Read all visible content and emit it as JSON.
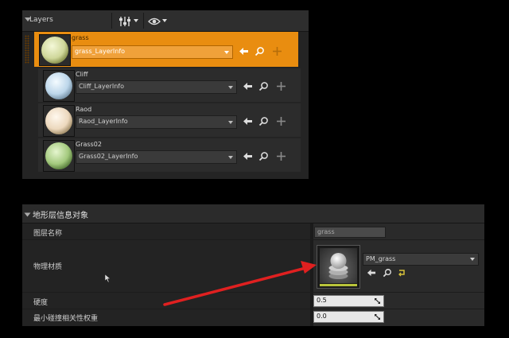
{
  "layers_panel": {
    "title": "Layers",
    "layers": [
      {
        "name": "grass",
        "info": "grass_LayerInfo",
        "selected": true,
        "thumb_color": "#d5dfa6"
      },
      {
        "name": "Cliff",
        "info": "Cliff_LayerInfo",
        "selected": false,
        "thumb_color": "#cfe3f2"
      },
      {
        "name": "Raod",
        "info": "Raod_LayerInfo",
        "selected": false,
        "thumb_color": "#f0e0c8"
      },
      {
        "name": "Grass02",
        "info": "Grass02_LayerInfo",
        "selected": false,
        "thumb_color": "#a9cf82"
      }
    ],
    "icons": [
      "left-arrow-icon",
      "search-icon",
      "plus-icon"
    ]
  },
  "details_panel": {
    "title": "地形层信息对象",
    "labels": {
      "layer_name": "图层名称",
      "physical_material": "物理材质",
      "hardness": "硬度",
      "min_blend_weight": "最小碰撞相关性权重"
    },
    "layer_name_value": "grass",
    "physical_material_value": "PM_grass",
    "hardness_value": "0.5",
    "min_blend_weight_value": "0.0"
  },
  "colors": {
    "selection": "#e98d10",
    "panel_bg": "#242424",
    "annotation_arrow": "#e02020"
  }
}
